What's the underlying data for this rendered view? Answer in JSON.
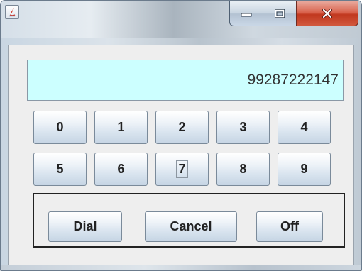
{
  "window": {
    "app_icon": "java-icon",
    "controls": {
      "minimize_icon": "minimize-icon",
      "maximize_icon": "maximize-icon",
      "close_icon": "close-icon"
    }
  },
  "display": {
    "value": "99287222147"
  },
  "keypad": {
    "row1": [
      "0",
      "1",
      "2",
      "3",
      "4"
    ],
    "row2": [
      "5",
      "6",
      "7",
      "8",
      "9"
    ]
  },
  "actions": {
    "dial_label": "Dial",
    "cancel_label": "Cancel",
    "off_label": "Off"
  },
  "colors": {
    "display_background": "#ccffff",
    "content_background": "#eeeeee",
    "close_button": "#c1381f"
  }
}
